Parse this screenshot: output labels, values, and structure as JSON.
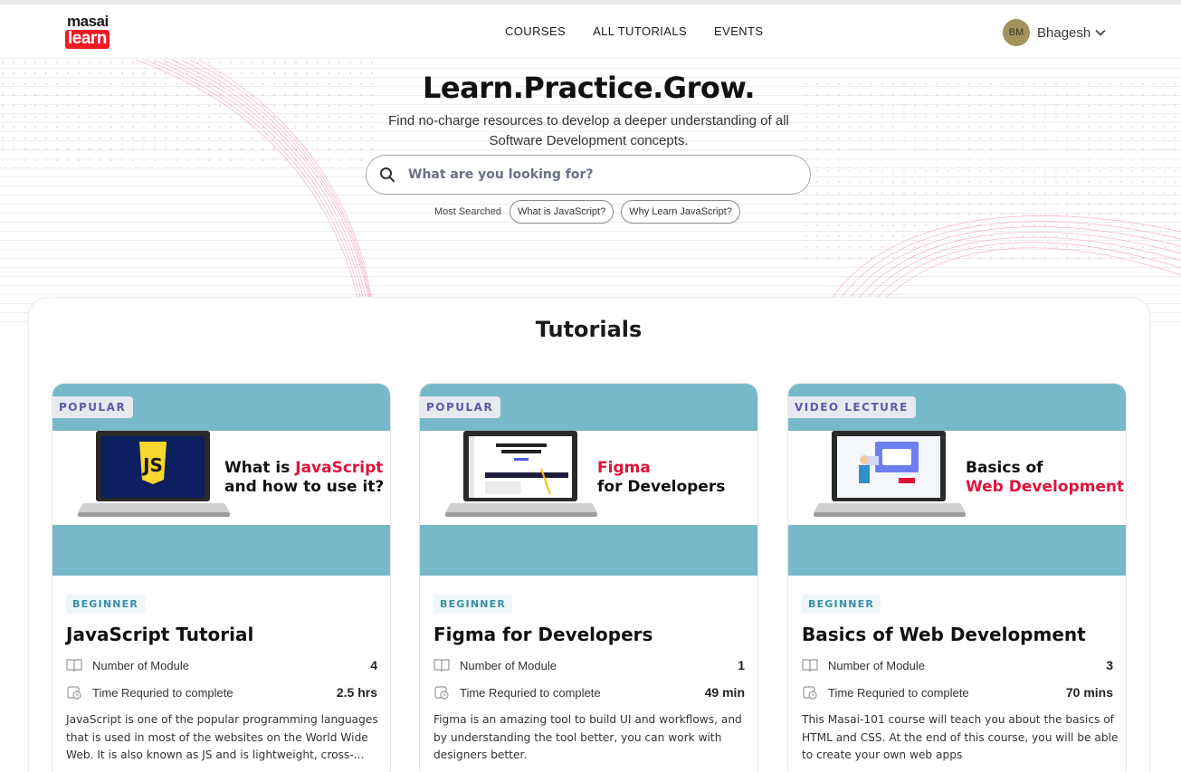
{
  "header": {
    "logo_top": "masai",
    "logo_bottom": "learn",
    "nav": [
      "COURSES",
      "ALL TUTORIALS",
      "EVENTS"
    ],
    "user_initials": "BM",
    "user_name": "Bhagesh"
  },
  "hero": {
    "title": "Learn.Practice.Grow.",
    "subtitle": "Find no-charge resources to develop a deeper understanding of all Software Development concepts.",
    "search_placeholder": "What are you looking for?",
    "most_searched_label": "Most Searched",
    "chips": [
      "What is JavaScript?",
      "Why Learn JavaScript?"
    ]
  },
  "tutorials": {
    "title": "Tutorials",
    "cards": [
      {
        "badge": "POPULAR",
        "thumb_line1_a": "What is ",
        "thumb_line1_b": "JavaScript",
        "thumb_line2": "and how to use it?",
        "level": "BEGINNER",
        "title": "JavaScript Tutorial",
        "modules_label": "Number of Module",
        "modules_value": "4",
        "time_label": "Time Requried to complete",
        "time_value": "2.5 hrs",
        "description": "JavaScript is one of the popular programming languages that is used in most of the websites on the World Wide Web. It is also known as JS and is lightweight, cross-..."
      },
      {
        "badge": "POPULAR",
        "thumb_line1_a": "",
        "thumb_line1_b": "Figma",
        "thumb_line2": "for Developers",
        "level": "BEGINNER",
        "title": "Figma for Developers",
        "modules_label": "Number of Module",
        "modules_value": "1",
        "time_label": "Time Requried to complete",
        "time_value": "49 min",
        "description": "Figma is an amazing tool to build UI and workflows, and by understanding the tool better, you can work with designers better."
      },
      {
        "badge": "VIDEO LECTURE",
        "thumb_line1_a": "Basics of",
        "thumb_line1_b": "",
        "thumb_line2": "Web Development",
        "level": "BEGINNER",
        "title": "Basics of Web Development",
        "modules_label": "Number of Module",
        "modules_value": "3",
        "time_label": "Time Requried to complete",
        "time_value": "70 mins",
        "description": "This Masai-101 course will teach you about the basics of HTML and CSS. At the end of this course, you will be able to create your own web apps"
      }
    ]
  },
  "colors": {
    "brand_red": "#ed1c24",
    "accent_red": "#e0133b",
    "thumb_teal": "#77b9c9",
    "badge_purple": "#5b5aa8",
    "level_teal": "#3a8ea8"
  },
  "icons": [
    "search-icon",
    "chevron-down-icon",
    "book-icon",
    "clock-icon",
    "laptop-icon",
    "js-shield-icon"
  ]
}
